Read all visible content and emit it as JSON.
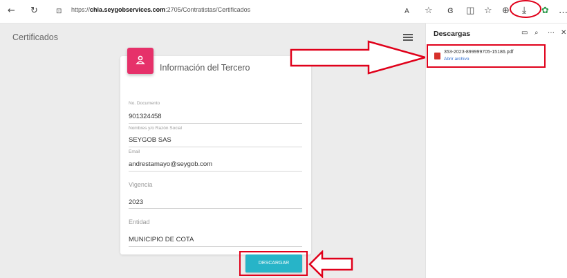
{
  "browser": {
    "url_prefix": "https://",
    "url_host": "chia.seygobservices.com",
    "url_path": ":2705/Contratistas/Certificados",
    "icons": [
      "back-arrow-icon",
      "refresh-icon",
      "lock-icon",
      "read-aloud-icon",
      "favorite-star-icon",
      "copilot-icon",
      "split-screen-icon",
      "favorites-icon",
      "collections-icon",
      "downloads-icon",
      "extension-icon",
      "more-icon"
    ]
  },
  "page": {
    "title": "Certificados"
  },
  "card": {
    "title": "Información del Tercero",
    "fields": {
      "doc_label": "No. Documento",
      "doc_value": "901324458",
      "name_label": "Nombres y/o Razón Social",
      "name_value": "SEYGOB SAS",
      "email_label": "Email",
      "email_value": "andrestamayo@seygob.com",
      "vigencia_label": "Vigencia",
      "vigencia_value": "2023",
      "entidad_label": "Entidad",
      "entidad_value": "MUNICIPIO DE COTA"
    },
    "download_button": "DESCARGAR"
  },
  "downloads_panel": {
    "title": "Descargas",
    "file_name": "353-2023-899999705-15186.pdf",
    "open_link": "Abrir archivo"
  },
  "colors": {
    "accent_pink": "#e6316a",
    "button_teal": "#27b4c8",
    "annotation_red": "#e0001a"
  }
}
